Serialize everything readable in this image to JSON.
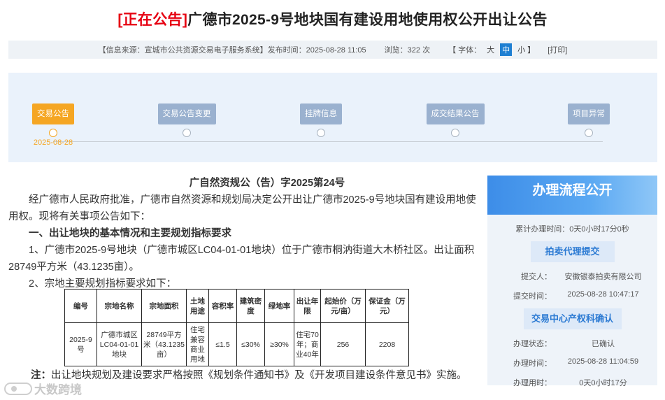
{
  "header": {
    "tag": "[正在公告]",
    "title": "广德市2025-9号地块国有建设用地使用权公开出让公告"
  },
  "info_bar": {
    "source": "【信息来源：宣城市公共资源交易电子服务系统】发布时间：2025-08-28 11:05",
    "views": "浏览：322 次",
    "font_label": "【 字体：",
    "font_large": "大",
    "font_medium": "中",
    "font_small": "小 】",
    "print": "[打印]"
  },
  "timeline": {
    "steps": [
      {
        "label": "交易公告",
        "date": "2025-08-28",
        "active": true
      },
      {
        "label": "交易公告变更",
        "date": "",
        "active": false
      },
      {
        "label": "挂牌信息",
        "date": "",
        "active": false
      },
      {
        "label": "成交结果公告",
        "date": "",
        "active": false
      },
      {
        "label": "项目异常",
        "date": "",
        "active": false
      }
    ]
  },
  "doc": {
    "doc_no": "广自然资规公（告）字2025第24号",
    "intro": "经广德市人民政府批准，广德市自然资源和规划局决定公开出让广德市2025-9号地块国有建设用地使用权。现将有关事项公告如下：",
    "section1": "一、出让地块的基本情况和主要规划指标要求",
    "item1": "1、广德市2025-9号地块（广德市城区LC04-01-01地块）位于广德市桐汭街道大木桥社区。出让面积28749平方米（43.1235亩）。",
    "item2": "2、宗地主要规划指标要求如下："
  },
  "table": {
    "headers": [
      "编号",
      "宗地名称",
      "宗地面积",
      "土地用途",
      "容积率",
      "建筑密度",
      "绿地率",
      "出让年限",
      "起始价（万元/亩）",
      "保证金（万元）"
    ],
    "rows": [
      [
        "2025-9号",
        "广德市城区LC04-01-01地块",
        "28749平方米（43.1235亩）",
        "住宅兼容商业用地",
        "≤1.5",
        "≤30%",
        "≥30%",
        "住宅70年；商业40年",
        "256",
        "2208"
      ]
    ]
  },
  "note": {
    "label": "注：",
    "text": "出让地块规划及建设要求严格按照《规划条件通知书》及《开发项目建设条件意见书》实施。"
  },
  "watermark": "大数跨境",
  "panel": {
    "title": "办理流程公开",
    "elapsed": "累计办理时间：0天0小时17分0秒",
    "stage1": "拍卖代理提交",
    "submitter_k": "提交人：",
    "submitter_v": "安徽银泰拍卖有限公司",
    "submit_time_k": "提交时间：",
    "submit_time_v": "2025-08-28 10:47:17",
    "stage2": "交易中心产权科确认",
    "status_k": "办理状态：",
    "status_v": "已确认",
    "handle_time_k": "办理时间：",
    "handle_time_v": "2025-08-28 11:04:59",
    "duration_k": "办理用时：",
    "duration_v": "0天0小时17分"
  },
  "colors": {
    "tag": "#e60012",
    "accent_orange": "#f5a623",
    "step_blue": "#9ab1cf",
    "panel_blue": "#3d8de8"
  }
}
